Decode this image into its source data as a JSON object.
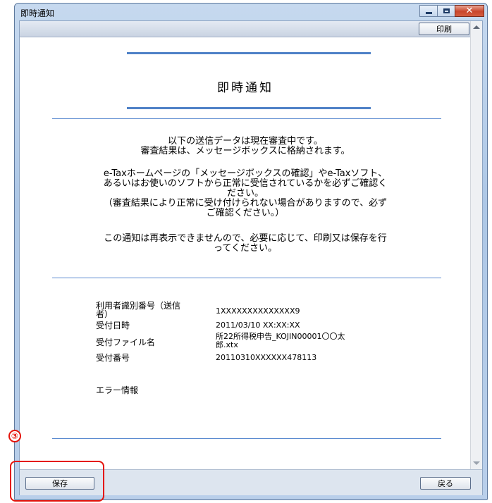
{
  "window": {
    "title": "即時通知"
  },
  "toolbar": {
    "print_label": "印刷"
  },
  "notice": {
    "heading": "即時通知",
    "msg1_line1": "以下の送信データは現在審査中です。",
    "msg1_line2": "審査結果は、メッセージボックスに格納されます。",
    "msg2_line1": "e-Taxホームページの「メッセージボックスの確認」やe-Taxソフト、",
    "msg2_line2": "あるいはお使いのソフトから正常に受信されているかを必ずご確認く",
    "msg2_line3": "ださい。",
    "msg2_line4": "（審査結果により正常に受け付けられない場合がありますので、必ず",
    "msg2_line5": "ご確認ください。）",
    "msg3_line1": "この通知は再表示できませんので、必要に応じて、印刷又は保存を行",
    "msg3_line2": "ってください。"
  },
  "info": {
    "user_id_label_1": "利用者識別番号（送信",
    "user_id_label_2": "者）",
    "user_id_value": "1XXXXXXXXXXXXXX9",
    "date_label": "受付日時",
    "date_value": "2011/03/10 XX:XX:XX",
    "file_label": "受付ファイル名",
    "file_value_1": "所22所得税申告_KOJIN00001〇〇太",
    "file_value_2": "郎.xtx",
    "number_label": "受付番号",
    "number_value": "20110310XXXXXX478113",
    "error_label": "エラー情報"
  },
  "annotation": {
    "number": "③",
    "color": "#e4140b"
  },
  "footer": {
    "save_label": "保存",
    "back_label": "戻る"
  }
}
